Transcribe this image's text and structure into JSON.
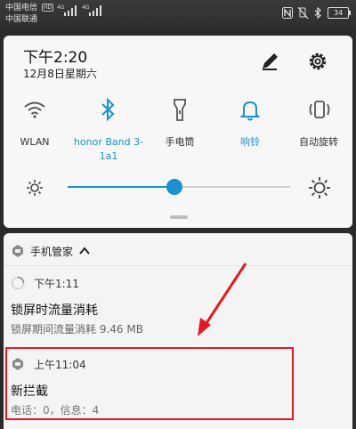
{
  "status_bar": {
    "carrier1": "中国电信",
    "carrier1_badge": "HD",
    "carrier2": "中国联通",
    "net1": "4G",
    "net2": "4G",
    "battery": "34",
    "icons": [
      "nfc-icon",
      "mute-icon",
      "bluetooth-icon",
      "battery-icon"
    ]
  },
  "panel": {
    "time": "下午2:20",
    "date": "12月8日星期六",
    "edit_icon": "pencil-icon",
    "settings_icon": "gear-icon",
    "toggles": [
      {
        "icon": "wifi-icon",
        "label": "WLAN",
        "active": false
      },
      {
        "icon": "bluetooth-icon",
        "label": "honor Band 3-1a1",
        "active": true
      },
      {
        "icon": "flashlight-icon",
        "label": "手电筒",
        "active": false
      },
      {
        "icon": "bell-icon",
        "label": "响铃",
        "active": true
      },
      {
        "icon": "rotate-icon",
        "label": "自动旋转",
        "active": false
      }
    ],
    "brightness": 0.48,
    "accent": "#1a8fd1"
  },
  "notifications": {
    "app_name": "手机管家",
    "items": [
      {
        "time": "下午1:11",
        "title": "锁屏时流量消耗",
        "body": "锁屏期间流量消耗 9.46 MB"
      },
      {
        "time": "上午11:04",
        "title": "新拦截",
        "body": "电话：0，信息：4"
      }
    ],
    "highlight_color": "#e01b24"
  }
}
